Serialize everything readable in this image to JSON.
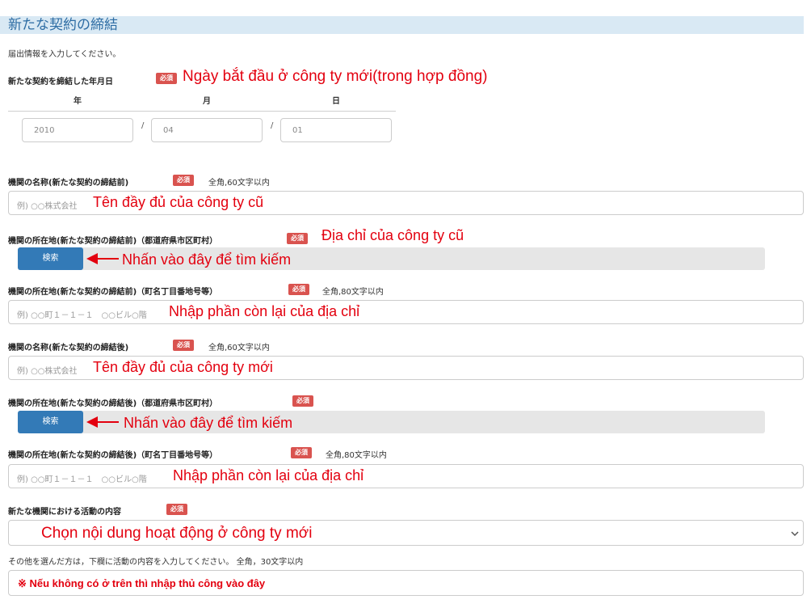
{
  "header": {
    "title": "新たな契約の締結",
    "intro": "届出情報を入力してください。"
  },
  "required_badge": "必須",
  "date": {
    "label": "新たな契約を締結した年月日",
    "annotation": "Ngày bắt đầu ở công ty mới(trong hợp đồng)",
    "year_label": "年",
    "month_label": "月",
    "day_label": "日",
    "year_value": "2010",
    "month_value": "04",
    "day_value": "01",
    "separator": "/"
  },
  "old_name": {
    "label": "機関の名称(新たな契約の締結前)",
    "hint": "全角,60文字以内",
    "placeholder": "例) ○○株式会社",
    "annotation": "Tên đầy đủ của công ty cũ"
  },
  "old_address_pref": {
    "label": "機関の所在地(新たな契約の締結前)（都道府県市区町村）",
    "annotation": "Địa chỉ của công ty cũ",
    "search_label": "検索",
    "search_annotation": "Nhấn vào đây để tìm kiếm"
  },
  "old_address_rest": {
    "label": "機関の所在地(新たな契約の締結前)（町名丁目番地号等）",
    "hint": "全角,80文字以内",
    "placeholder": "例) ○○町１－１－１　○○ビル○階",
    "annotation": "Nhập phần còn lại của địa chỉ"
  },
  "new_name": {
    "label": "機関の名称(新たな契約の締結後)",
    "hint": "全角,60文字以内",
    "placeholder": "例) ○○株式会社",
    "annotation": "Tên đầy đủ của công ty mới"
  },
  "new_address_pref": {
    "label": "機関の所在地(新たな契約の締結後)（都道府県市区町村）",
    "search_label": "検索",
    "search_annotation": "Nhấn vào đây để tìm kiếm"
  },
  "new_address_rest": {
    "label": "機関の所在地(新たな契約の締結後)（町名丁目番地号等）",
    "hint": "全角,80文字以内",
    "placeholder": "例) ○○町１－１－１　○○ビル○階",
    "annotation": "Nhập phần còn lại của địa chỉ"
  },
  "activity": {
    "label": "新たな機関における活動の内容",
    "select_annotation": "Chọn nội dung hoạt động ở công ty mới",
    "other_label": "その他を選んだ方は，下欄に活動の内容を入力してください。 全角，30文字以内",
    "other_annotation": "※ Nếu không có ở trên thì nhập thủ công vào đây"
  },
  "colors": {
    "accent": "#337ab7",
    "badge": "#d9534f",
    "annotation": "#e3000f",
    "header_bg": "#d9e9f4"
  }
}
